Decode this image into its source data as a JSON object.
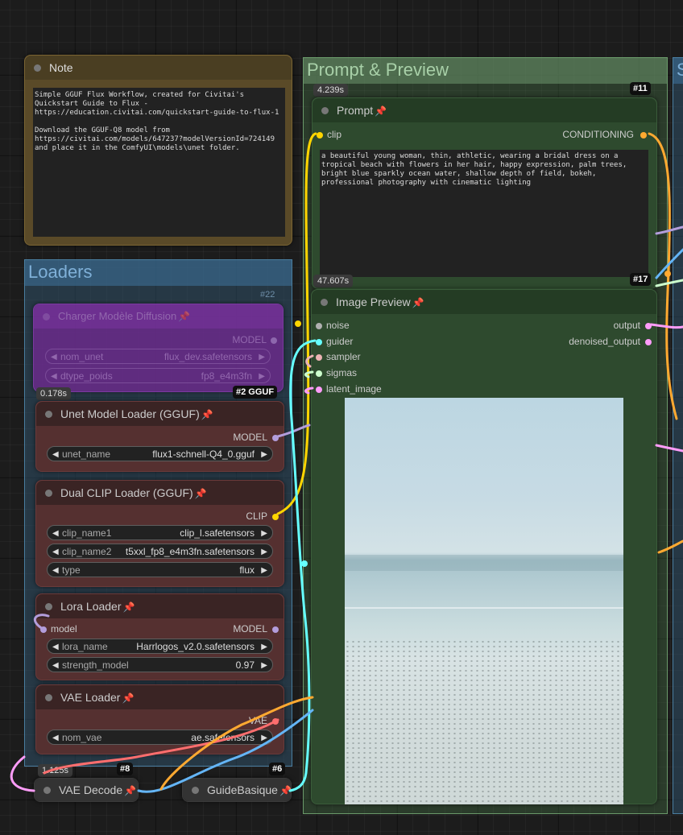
{
  "groups": {
    "prompt_preview": {
      "title": "Prompt & Preview"
    },
    "loaders": {
      "title": "Loaders"
    },
    "right_edge": {
      "title": "S"
    }
  },
  "note": {
    "title": "Note",
    "text": "Simple GGUF Flux Workflow, created for Civitai's\nQuickstart Guide to Flux -\nhttps://education.civitai.com/quickstart-guide-to-flux-1\n\nDownload the GGUF-Q8 model from\nhttps://civitai.com/models/647237?modelVersionId=724149\nand place it in the ComfyUI\\models\\unet folder."
  },
  "prompt_node": {
    "timing": "4.239s",
    "id": "#11",
    "title": "Prompt",
    "input": "clip",
    "output": "CONDITIONING",
    "text": "a beautiful young woman, thin, athletic, wearing a bridal dress on a\ntropical beach with flowers in her hair, happy expression, palm trees,\nbright blue sparkly ocean water, shallow depth of field, bokeh,\nprofessional photography with cinematic lighting"
  },
  "image_preview": {
    "timing": "47.607s",
    "id": "#17",
    "title": "Image Preview",
    "inputs": [
      "noise",
      "guider",
      "sampler",
      "sigmas",
      "latent_image"
    ],
    "outputs": [
      "output",
      "denoised_output"
    ]
  },
  "charger": {
    "id": "#22",
    "title": "Charger Modèle Diffusion",
    "output": "MODEL",
    "widgets": [
      {
        "label": "nom_unet",
        "value": "flux_dev.safetensors"
      },
      {
        "label": "dtype_poids",
        "value": "fp8_e4m3fn"
      }
    ]
  },
  "unet_loader": {
    "timing": "0.178s",
    "id": "#2 GGUF",
    "title": "Unet Model Loader (GGUF)",
    "output": "MODEL",
    "widgets": [
      {
        "label": "unet_name",
        "value": "flux1-schnell-Q4_0.gguf"
      }
    ]
  },
  "dual_clip": {
    "title": "Dual CLIP Loader (GGUF)",
    "output": "CLIP",
    "widgets": [
      {
        "label": "clip_name1",
        "value": "clip_l.safetensors"
      },
      {
        "label": "clip_name2",
        "value": "t5xxl_fp8_e4m3fn.safetensors"
      },
      {
        "label": "type",
        "value": "flux"
      }
    ]
  },
  "lora": {
    "title": "Lora Loader",
    "input": "model",
    "output": "MODEL",
    "widgets": [
      {
        "label": "lora_name",
        "value": "Harrlogos_v2.0.safetensors"
      },
      {
        "label": "strength_model",
        "value": "0.97"
      }
    ]
  },
  "vae_loader": {
    "title": "VAE Loader",
    "output": "VAE",
    "widgets": [
      {
        "label": "nom_vae",
        "value": "ae.safetensors"
      }
    ]
  },
  "vae_decode": {
    "timing": "1.125s",
    "id": "#8",
    "title": "VAE Decode"
  },
  "guide": {
    "id": "#6",
    "title": "GuideBasique"
  },
  "colors": {
    "clip": "#ffd500",
    "conditioning": "#ffa931",
    "model": "#b39ddb",
    "vae": "#ff6e6e",
    "noise": "#b0b0b0",
    "guider": "#66ffff",
    "sampler": "#ecb4b4",
    "sigmas": "#cdffcd",
    "latent": "#ff9cf9",
    "image": "#64b5f6"
  }
}
